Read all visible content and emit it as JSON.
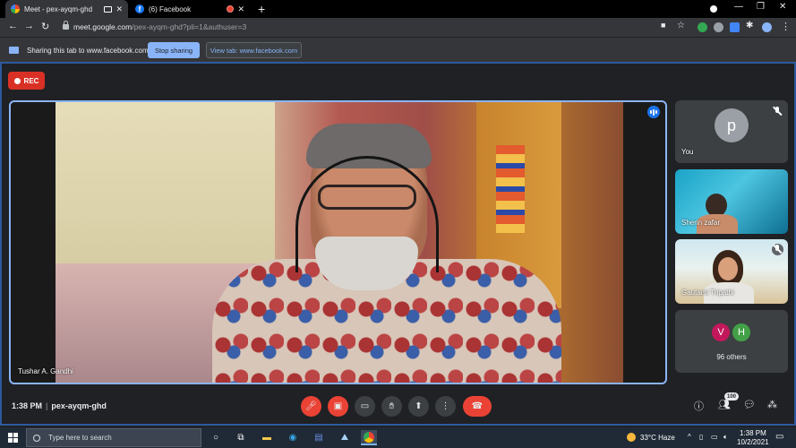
{
  "browser": {
    "tabs": [
      {
        "title": "Meet - pex-ayqm-ghd",
        "active": true
      },
      {
        "title": "(6) Facebook",
        "active": false
      }
    ],
    "new_tab_icon": "plus-icon",
    "url_host": "meet.google.com",
    "url_path": "/pex-ayqm-ghd?pli=1&authuser=3"
  },
  "sharing_bar": {
    "text": "Sharing this tab to www.facebook.com",
    "stop_label": "Stop sharing",
    "view_label": "View tab: www.facebook.com"
  },
  "meet": {
    "rec_label": "REC",
    "main_speaker": "Tushar A. Gandhi",
    "participants": [
      {
        "name": "You",
        "avatar_letter": "p",
        "muted": true
      },
      {
        "name": "Sherin zafar"
      },
      {
        "name": "Gautami Tripathi",
        "muted": true
      }
    ],
    "others": {
      "avatars": [
        "V",
        "H"
      ],
      "label": "96 others"
    },
    "time": "1:38 PM",
    "meeting_code": "pex-ayqm-ghd",
    "people_count": "100",
    "colors": {
      "accent": "#8ab4f8",
      "red": "#ea4335",
      "avatar_v": "#c2185b",
      "avatar_h": "#43a047"
    }
  },
  "taskbar": {
    "search_placeholder": "Type here to search",
    "weather": "33°C  Haze",
    "time": "1:38 PM",
    "date": "10/2/2021"
  }
}
